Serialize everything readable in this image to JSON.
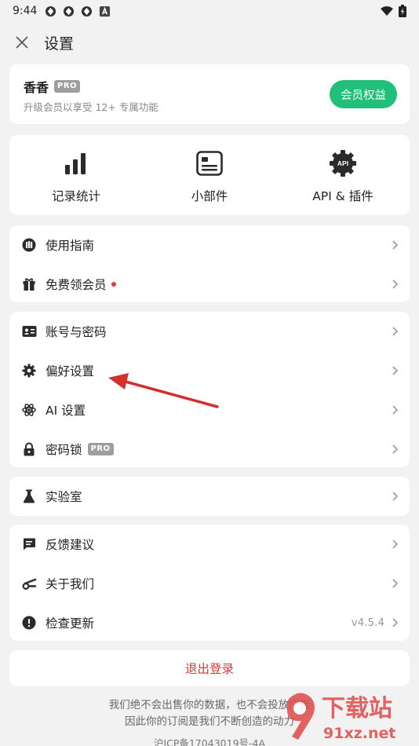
{
  "status_bar": {
    "time": "9:44"
  },
  "header": {
    "title": "设置"
  },
  "member": {
    "name": "香香",
    "badge": "PRO",
    "subtitle": "升级会员以享受 12+ 专属功能",
    "button": "会员权益"
  },
  "features": [
    {
      "label": "记录统计"
    },
    {
      "label": "小部件"
    },
    {
      "label": "API & 插件"
    }
  ],
  "feature_icon_text": "API",
  "groups": {
    "guide": [
      {
        "label": "使用指南"
      },
      {
        "label": "免费领会员"
      }
    ],
    "account": [
      {
        "label": "账号与密码"
      },
      {
        "label": "偏好设置"
      },
      {
        "label": "AI 设置"
      },
      {
        "label": "密码锁",
        "badge": "PRO"
      }
    ],
    "lab": [
      {
        "label": "实验室"
      }
    ],
    "about": [
      {
        "label": "反馈建议"
      },
      {
        "label": "关于我们"
      },
      {
        "label": "检查更新",
        "value": "v4.5.4"
      }
    ]
  },
  "logout": {
    "label": "退出登录"
  },
  "footer": {
    "line1": "我们绝不会出售你的数据，也不会投放广告",
    "line2": "因此你的订阅是我们不断创造的动力",
    "icp": "沪ICP备17043019号-4A"
  },
  "watermark": {
    "text1": "下载站",
    "text2": "91xz.net"
  },
  "colors": {
    "accent_green": "#21c07a",
    "logout_red": "#d03a3a",
    "arrow_red": "#d32f2f"
  }
}
